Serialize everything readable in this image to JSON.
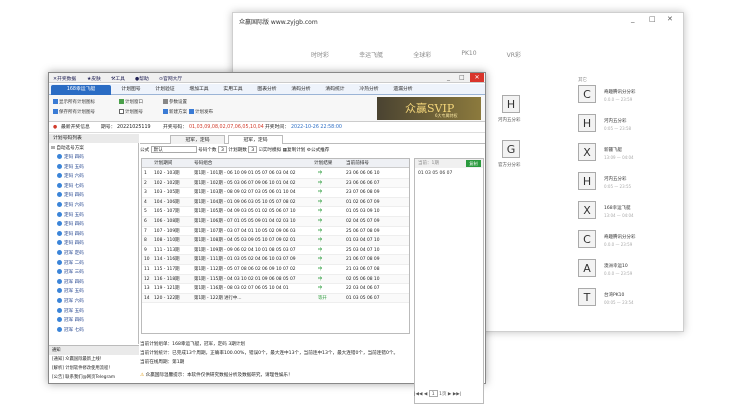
{
  "back_window": {
    "title": "众赢国际版 www.zyjgb.com",
    "min": "_",
    "max": "□",
    "close": "✕",
    "tabs": [
      "时时彩",
      "幸运飞艇",
      "全球彩",
      "PK10",
      "VR彩"
    ],
    "middle_label": "其它",
    "left_games": [
      {
        "icon": "H",
        "name": "河内五分彩"
      },
      {
        "icon": "G",
        "name": "官方分分彩"
      }
    ],
    "right_games": [
      {
        "icon": "C",
        "name": "奇趣腾讯分分彩",
        "time": "0.0.0 — 23:59"
      },
      {
        "icon": "H",
        "name": "河内五分彩",
        "time": "0:05 — 23:58"
      },
      {
        "icon": "X",
        "name": "新疆飞艇",
        "time": "13:09 — 04:04"
      },
      {
        "icon": "H",
        "name": "河内五分彩",
        "time": "0:05 — 23:55"
      },
      {
        "icon": "X",
        "name": "168幸运飞艇",
        "time": "13:04 — 04:04"
      },
      {
        "icon": "C",
        "name": "奇趣腾讯分分彩",
        "time": "0.0.0 — 23:59"
      },
      {
        "icon": "A",
        "name": "澳洲幸运10",
        "time": "0.0.0 — 23:59"
      },
      {
        "icon": "T",
        "name": "台湾PK10",
        "time": "00:05 — 23:54"
      }
    ]
  },
  "front_window": {
    "menu": [
      "✕开奖数据",
      "★皮肤",
      "⚒工具",
      "●帮助",
      "⊙官网大厅"
    ],
    "tabs": [
      "168幸运飞艇",
      "计划图号",
      "计划验证",
      "增加工具",
      "实用工具",
      "图表分析",
      "清码分析",
      "清码统计",
      "冷热分析",
      "遗漏分析"
    ],
    "ribbon": {
      "col1": [
        "显示所有计划图标",
        "保存所有计划图号"
      ],
      "col2": [
        "计划窗口",
        "计划图号"
      ],
      "col3": [
        "参数设置",
        "新建方案",
        "计划发布"
      ]
    },
    "banner_text": "众赢SVIP",
    "banner_sub": "6大专属特权",
    "info": {
      "latest_label": "最新开奖信息",
      "period_label": "期号：",
      "period": "20221025119",
      "open_label": "开奖号码：",
      "numbers": "01,03,09,08,02,07,06,05,10,04",
      "time_label": "开奖时间：",
      "time": "2022-10-26 22:58:00"
    },
    "left_pane": {
      "header": "计划号码列表",
      "root": "自动选号方案",
      "items": [
        "定码 四码",
        "定码 五码",
        "定码 六码",
        "定码 七码",
        "定码 四码",
        "定码 六码",
        "定码 五码",
        "定码 四码",
        "定码 四码",
        "定码 四码",
        "冠军 定码",
        "冠军 二码",
        "冠军 三码",
        "冠军 四码",
        "冠军 五码",
        "冠军 六码",
        "冠军 五码",
        "冠军 四码",
        "冠军 七码"
      ]
    },
    "notes": [
      "通知",
      "[通知] 众赢国际最新上线！",
      "[解析] 计划软件修改使用流程！",
      "[公告] 联系我们@网页Telegram"
    ],
    "subtabs": [
      "冠军，定码",
      "冠军，定码"
    ],
    "toolbar": {
      "mode_label": "公式",
      "mode_val": "默认",
      "num_label": "号码个数",
      "num_val": "3",
      "period_label": "计划期数",
      "period_val": "3",
      "opt1": "实时模拟",
      "opt2": "复制计划",
      "opt3": "公式推荐"
    },
    "grid_headers": [
      "",
      "计划期间",
      "号码组合",
      "计划结果",
      "当前前排号"
    ],
    "rows": [
      {
        "no": "1",
        "span": "102 - 103期",
        "plan": "第1期 - 101期 - 06 10 09 01 05 07 06 03 04 02",
        "res": "中",
        "cur": "23 06 06 06 10"
      },
      {
        "no": "2",
        "span": "102 - 102期",
        "plan": "第1期 - 102期 - 05 03 06 07 09 06 10 01 04 02",
        "res": "中",
        "cur": "23 06 06 06 07"
      },
      {
        "no": "3",
        "span": "103 - 105期",
        "plan": "第1期 - 103期 - 08 09 02 07 03 05 06 01 10 04",
        "res": "中",
        "cur": "23 07 06 08 09"
      },
      {
        "no": "4",
        "span": "104 - 106期",
        "plan": "第1期 - 104期 - 01 09 06 03 05 10 05 07 08 02",
        "res": "中",
        "cur": "01 02 06 07 09"
      },
      {
        "no": "5",
        "span": "105 - 107期",
        "plan": "第1期 - 105期 - 04 09 03 05 01 02 05 06 07 10",
        "res": "中",
        "cur": "01 05 03 09 10"
      },
      {
        "no": "6",
        "span": "106 - 108期",
        "plan": "第1期 - 106期 - 07 01 05 05 09 01 04 02 03 10",
        "res": "中",
        "cur": "02 04 05 07 09"
      },
      {
        "no": "7",
        "span": "107 - 109期",
        "plan": "第1期 - 107期 - 03 07 04 01 10 05 02 09 06 03",
        "res": "中",
        "cur": "25 06 07 08 09"
      },
      {
        "no": "8",
        "span": "108 - 110期",
        "plan": "第1期 - 108期 - 04 05 03 09 05 10 07 09 02 01",
        "res": "中",
        "cur": "01 03 04 07 10"
      },
      {
        "no": "9",
        "span": "111 - 113期",
        "plan": "第1期 - 109期 - 09 06 02 04 10 01 08 05 03 07",
        "res": "中",
        "cur": "25 03 04 07 10"
      },
      {
        "no": "10",
        "span": "114 - 116期",
        "plan": "第1期 - 111期 - 01 03 05 02 04 06 10 03 07 09",
        "res": "中",
        "cur": "21 06 07 08 09"
      },
      {
        "no": "11",
        "span": "115 - 117期",
        "plan": "第1期 - 112期 - 05 07 08 06 02 06 09 10 07 02",
        "res": "中",
        "cur": "21 03 06 07 08"
      },
      {
        "no": "12",
        "span": "116 - 118期",
        "plan": "第1期 - 115期 - 04 03 10 02 01 09 06 08 05 07",
        "res": "中",
        "cur": "02 05 06 08 10"
      },
      {
        "no": "13",
        "span": "119 - 121期",
        "plan": "第1期 - 116期 - 08 03 02 07 06 05 10 04 01",
        "res": "中",
        "cur": "22 03 04 06 07"
      },
      {
        "no": "14",
        "span": "120 - 122期",
        "plan": "第1期 - 122期 进行中...",
        "res": "等开",
        "cur": "01 03 05 06 07"
      }
    ],
    "rpanel": {
      "head": "当前：1期",
      "btn": "复制",
      "value": "01 03 05 06 07"
    },
    "pager": {
      "first": "|◀◀",
      "prev": "◀",
      "page": "1",
      "of": "1页",
      "next": "▶",
      "last": "▶▶|"
    },
    "stats": [
      "当前计划组单：168幸运飞艇，冠军，定码   3期计划",
      "当前计划统计：已完成13个周期，正确率100.00%，错误0个，最大连中13个，当前连中13个，最大连错0个，当前连错0个。",
      "当前在线周期：第1期"
    ],
    "footer": "众赢国际温馨提示：本软件仅供研究数据分析及数据研究，请理性娱乐！"
  }
}
